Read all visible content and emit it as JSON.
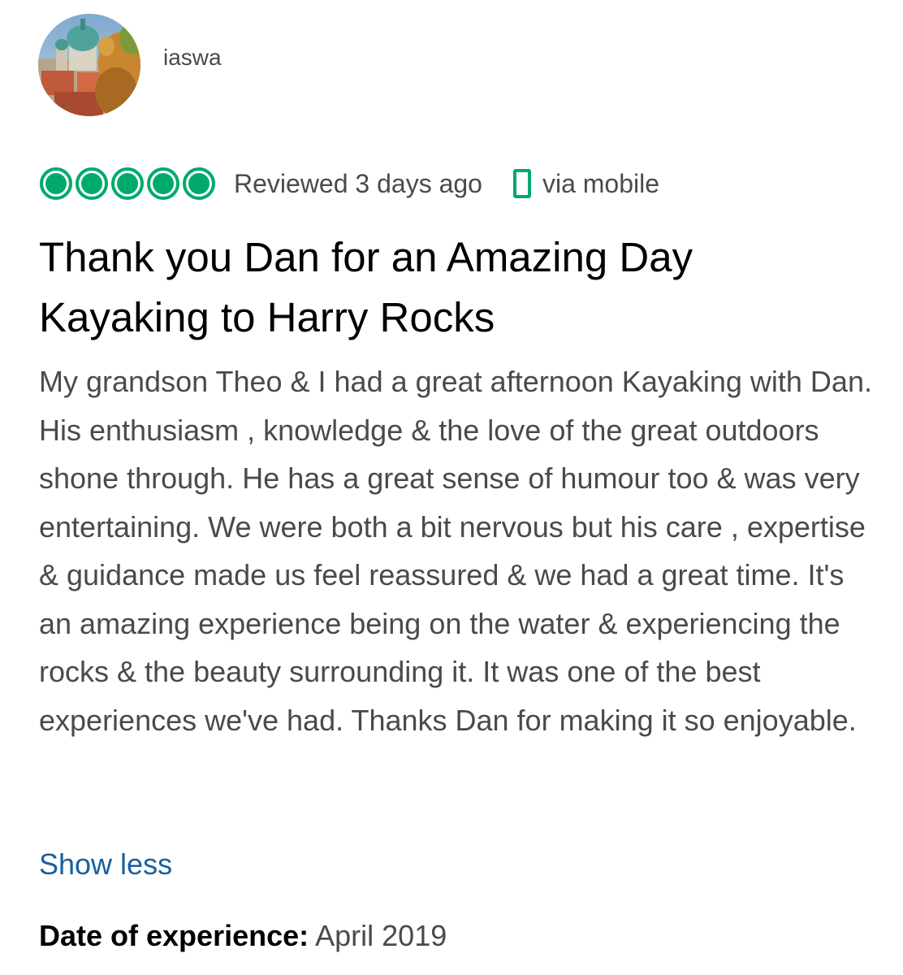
{
  "reviewer": {
    "username": "iaswa",
    "avatar_icon": "avatar-photo"
  },
  "review": {
    "rating": 5,
    "rating_max": 5,
    "rating_color": "#00aa6c",
    "reviewed_text": "Reviewed 3 days ago",
    "device_icon": "mobile-phone-icon",
    "via_text": "via mobile",
    "title": "Thank you Dan for an Amazing Day Kayaking to Harry Rocks",
    "body": "My grandson Theo & I had a great afternoon Kayaking with Dan. His enthusiasm , knowledge & the love of the great outdoors shone through. He has a great sense of humour too & was very entertaining. We were both a bit nervous but his care , expertise & guidance made us feel reassured & we had a great time. It's an amazing experience being on the water & experiencing the rocks & the beauty surrounding it. It was one of the best experiences we've had. Thanks Dan for making it so enjoyable.",
    "show_less_label": "Show less",
    "link_color": "#1a5fa0",
    "date_label": "Date of experience:",
    "date_value": "April 2019"
  }
}
